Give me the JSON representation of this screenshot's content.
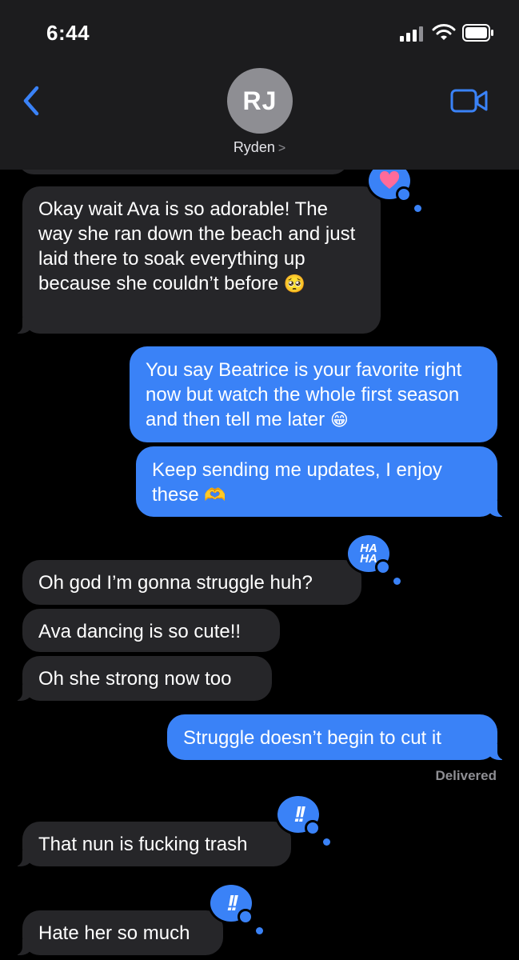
{
  "status_bar": {
    "time": "6:44"
  },
  "header": {
    "avatar_initials": "RJ",
    "contact_name": "Ryden",
    "chevron": ">"
  },
  "colors": {
    "outgoing": "#3a82f7",
    "incoming": "#262629",
    "background": "#000000"
  },
  "messages": [
    {
      "direction": "in",
      "text": "Okay wait Ava is so adorable! The way she ran down the beach and just laid there to soak everything up because she couldn’t before",
      "emoji": "🥺",
      "tapback": "heart"
    },
    {
      "direction": "out",
      "text": "You say Beatrice is your favorite right now but watch the whole first season and then tell me later",
      "emoji": "😁"
    },
    {
      "direction": "out",
      "text": "Keep sending me updates, I enjoy these",
      "emoji": "🫶"
    },
    {
      "direction": "in",
      "text": "Oh god I’m gonna struggle huh?",
      "tapback": "haha"
    },
    {
      "direction": "in",
      "text": "Ava dancing is so cute!!"
    },
    {
      "direction": "in",
      "text": "Oh she strong now too"
    },
    {
      "direction": "out",
      "text": "Struggle doesn’t begin to cut it"
    },
    {
      "direction": "in",
      "text": "That nun is fucking trash",
      "tapback": "emphasis"
    },
    {
      "direction": "in",
      "text": "Hate her so much",
      "tapback": "emphasis"
    }
  ],
  "tapback_labels": {
    "haha": "HA HA",
    "emphasis": "!!"
  },
  "delivered_label": "Delivered"
}
